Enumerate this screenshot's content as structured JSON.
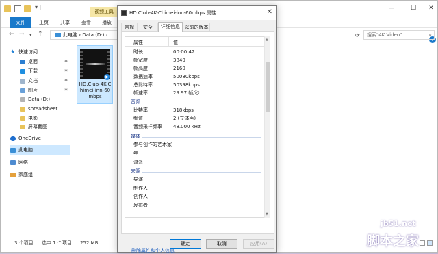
{
  "explorer": {
    "context_tab": "视频工具",
    "tabs": [
      "文件",
      "主页",
      "共享",
      "查看",
      "播放"
    ],
    "address": {
      "crumbs": "此电脑 › Data (D:) ›"
    },
    "search_placeholder": "搜索\"4K Video\"",
    "nav": [
      {
        "label": "快速访问",
        "icon": "star-icon",
        "pinned": false
      },
      {
        "label": "桌面",
        "icon": "desktop-icon",
        "pinned": true
      },
      {
        "label": "下载",
        "icon": "download-icon",
        "pinned": true
      },
      {
        "label": "文档",
        "icon": "document-icon",
        "pinned": true
      },
      {
        "label": "图片",
        "icon": "picture-icon",
        "pinned": true
      },
      {
        "label": "Data (D:)",
        "icon": "drive-icon",
        "pinned": false
      },
      {
        "label": "spreadsheet",
        "icon": "folder-icon",
        "pinned": false
      },
      {
        "label": "电影",
        "icon": "folder-icon",
        "pinned": false
      },
      {
        "label": "屏幕截图",
        "icon": "folder-icon",
        "pinned": false
      },
      {
        "label": "OneDrive",
        "icon": "onedrive-icon",
        "pinned": false
      },
      {
        "label": "此电脑",
        "icon": "this-pc-icon",
        "pinned": false
      },
      {
        "label": "网络",
        "icon": "network-icon",
        "pinned": false
      },
      {
        "label": "家庭组",
        "icon": "homegroup-icon",
        "pinned": false
      }
    ],
    "file": {
      "name": "HD.Club-4K-Chimei-inn-60mbps"
    },
    "status": {
      "count": "3 个项目",
      "selected": "选中 1 个项目",
      "size": "252 MB"
    }
  },
  "dialog": {
    "title": "HD.Club-4K-Chimei-inn-60mbps 属性",
    "tabs": [
      "常规",
      "安全",
      "详细信息",
      "以前的版本"
    ],
    "active_tab": "详细信息",
    "columns": {
      "name": "属性",
      "value": "值"
    },
    "video": [
      {
        "k": "时长",
        "v": "00:00:42"
      },
      {
        "k": "帧宽度",
        "v": "3840"
      },
      {
        "k": "帧高度",
        "v": "2160"
      },
      {
        "k": "数据速率",
        "v": "50080kbps"
      },
      {
        "k": "总比特率",
        "v": "50398kbps"
      },
      {
        "k": "帧速率",
        "v": "29.97 帧/秒"
      }
    ],
    "audio_group": "音频",
    "audio": [
      {
        "k": "比特率",
        "v": "318kbps"
      },
      {
        "k": "频道",
        "v": "2 (立体声)"
      },
      {
        "k": "音频采样频率",
        "v": "48.000 kHz"
      }
    ],
    "media_group": "媒体",
    "media": [
      {
        "k": "参与创作的艺术家",
        "v": ""
      },
      {
        "k": "年",
        "v": ""
      },
      {
        "k": "流派",
        "v": ""
      }
    ],
    "origin_group": "来源",
    "origin": [
      {
        "k": "导演",
        "v": ""
      },
      {
        "k": "制作人",
        "v": ""
      },
      {
        "k": "创作人",
        "v": ""
      },
      {
        "k": "发布者",
        "v": ""
      }
    ],
    "remove_link": "删除属性和个人信息",
    "buttons": {
      "ok": "确定",
      "cancel": "取消",
      "apply": "应用(A)"
    }
  },
  "watermark": {
    "site": "jb51.net",
    "name": "脚本之家"
  }
}
